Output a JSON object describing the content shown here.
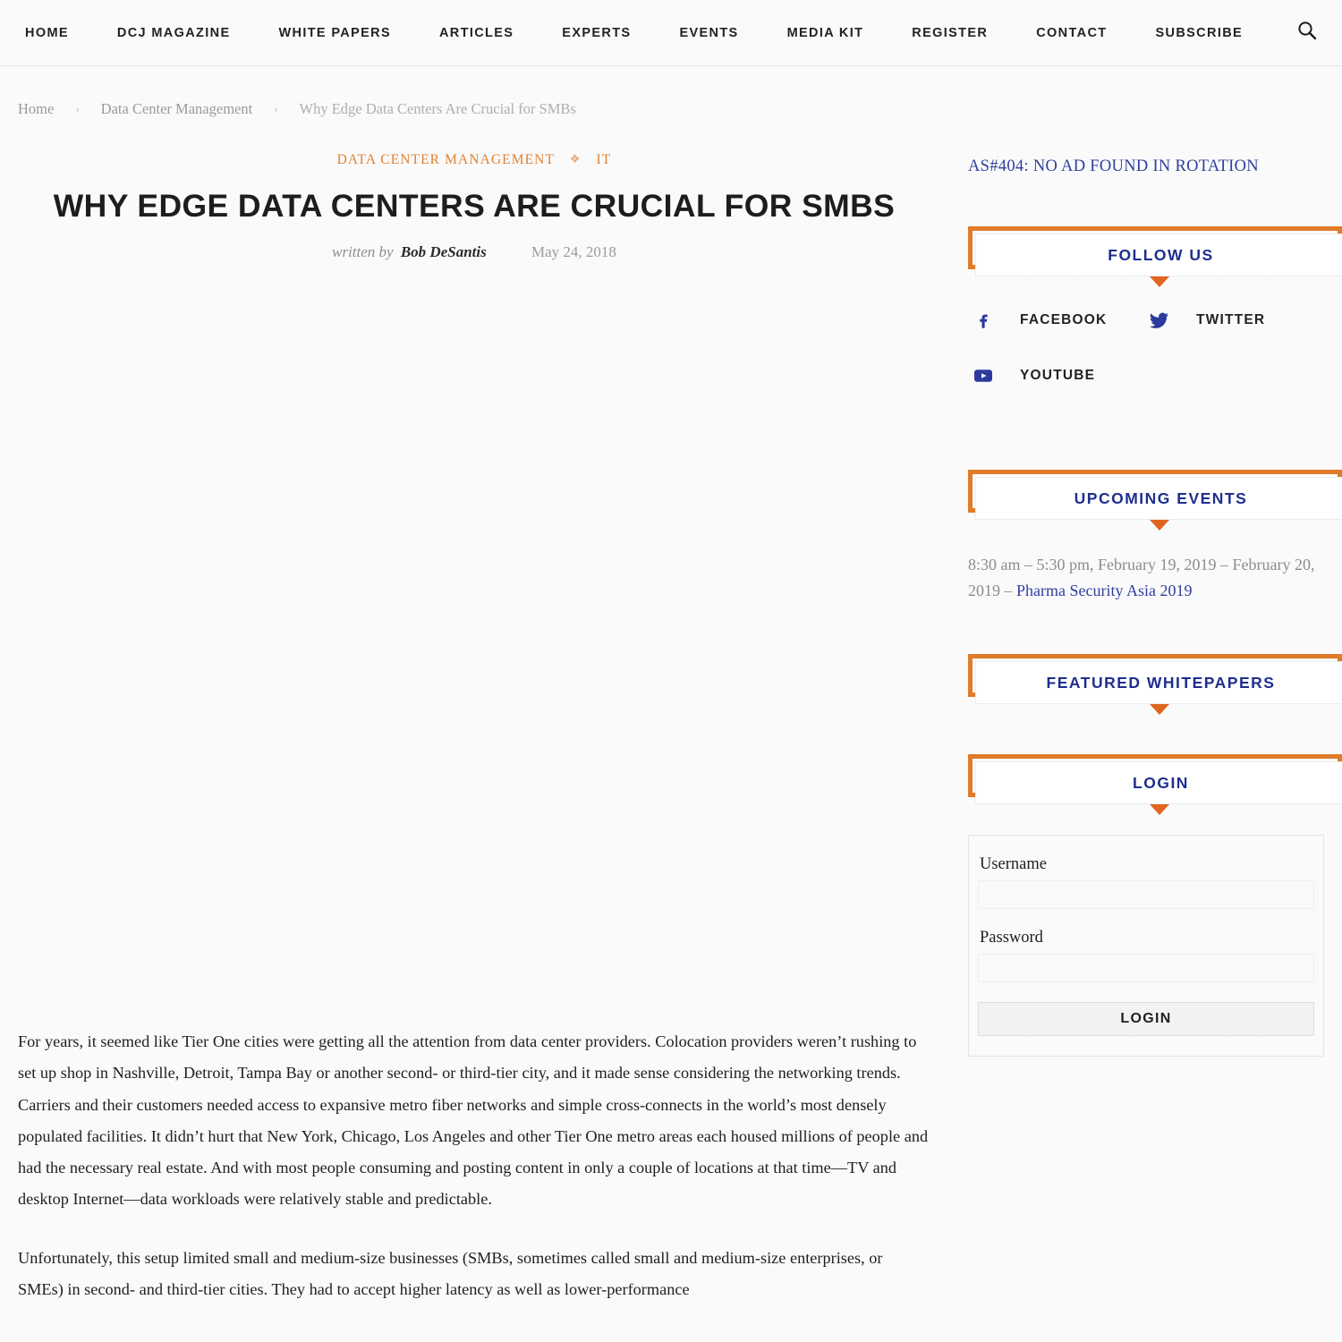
{
  "nav": {
    "items": [
      {
        "label": "HOME"
      },
      {
        "label": "DCJ MAGAZINE"
      },
      {
        "label": "WHITE PAPERS"
      },
      {
        "label": "ARTICLES"
      },
      {
        "label": "EXPERTS"
      },
      {
        "label": "EVENTS"
      },
      {
        "label": "MEDIA KIT"
      },
      {
        "label": "REGISTER"
      },
      {
        "label": "CONTACT"
      },
      {
        "label": "SUBSCRIBE"
      }
    ],
    "search_icon": "search-icon"
  },
  "breadcrumb": {
    "home": "Home",
    "separator": "›",
    "section": "Data Center Management",
    "current": "Why Edge Data Centers Are Crucial for SMBs"
  },
  "article": {
    "categories": [
      "DATA CENTER MANAGEMENT",
      "IT"
    ],
    "category_separator": "❖",
    "title": "WHY EDGE DATA CENTERS ARE CRUCIAL FOR SMBS",
    "written_by_label": "written by",
    "author": "Bob DeSantis",
    "date": "May 24, 2018",
    "paragraphs": [
      "For years, it seemed like Tier One cities were getting all the attention from data center providers. Colocation providers weren’t rushing to set up shop in Nashville, Detroit, Tampa Bay or another second- or third-tier city, and it made sense considering the networking trends. Carriers and their customers needed access to expansive metro fiber networks and simple cross-connects in the world’s most densely populated facilities. It didn’t hurt that New York, Chicago, Los Angeles and other Tier One metro areas each housed millions of people and had the necessary real estate. And with most people consuming and posting content in only a couple of locations at that time—TV and desktop Internet—data workloads were relatively stable and predictable.",
      "Unfortunately, this setup limited small and medium-size businesses (SMBs, sometimes called small and medium-size enterprises, or SMEs) in second- and third-tier cities. They had to accept higher latency as well as lower-performance"
    ]
  },
  "sidebar": {
    "ad_notice": "AS#404: NO AD FOUND IN ROTATION",
    "follow_us": {
      "title": "FOLLOW US",
      "links": [
        {
          "label": "FACEBOOK",
          "icon": "facebook-icon"
        },
        {
          "label": "TWITTER",
          "icon": "twitter-icon"
        },
        {
          "label": "YOUTUBE",
          "icon": "youtube-icon"
        }
      ]
    },
    "upcoming_events": {
      "title": "UPCOMING EVENTS",
      "event_time": "8:30 am – 5:30 pm, February 19, 2019 – February 20, 2019 – ",
      "event_link": "Pharma Security Asia 2019"
    },
    "featured_whitepapers": {
      "title": "FEATURED WHITEPAPERS"
    },
    "login": {
      "title": "LOGIN",
      "username_label": "Username",
      "username_value": "",
      "password_label": "Password",
      "password_value": "",
      "submit_label": "LOGIN"
    }
  },
  "colors": {
    "accent_orange": "#e07b2a",
    "link_blue": "#2f3f9e",
    "category_orange": "#e08030",
    "page_bg": "#fafafa"
  }
}
